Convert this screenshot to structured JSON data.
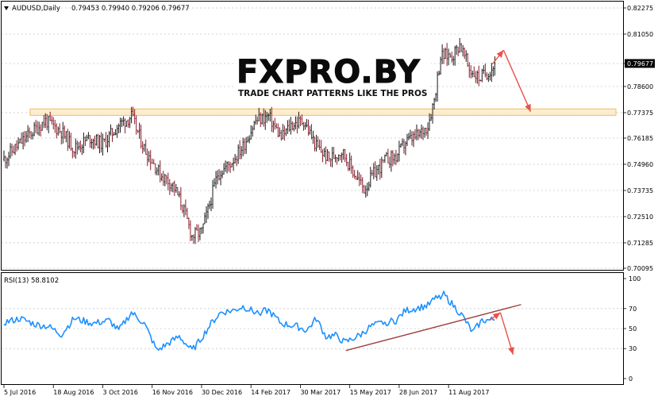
{
  "header": {
    "symbol_label": "AUDUSD,Daily",
    "ohlc": "0.79453 0.79940 0.79206 0.79677"
  },
  "logo": {
    "title": "FXPRO.BY",
    "tagline": "TRADE CHART PATTERNS LIKE THE PROS"
  },
  "rsi_header": {
    "label": "RSI(13) 58.8102"
  },
  "current_price_label": "0.79677",
  "colors": {
    "bull": "#1a1a1a",
    "bear": "#8a1c2a",
    "rsi_line": "#1e90ff",
    "arrow": "#e8524a",
    "trendline": "#a04040",
    "zone_fill": "#fdebc8",
    "zone_stroke": "#f0b040",
    "grid": "#c8c8c8"
  },
  "chart_data": [
    {
      "type": "candlestick",
      "title": "AUDUSD,Daily",
      "ylim": [
        0.70095,
        0.82275
      ],
      "y_ticks": [
        "0.82275",
        "0.81050",
        "0.79677",
        "0.78600",
        "0.77375",
        "0.76185",
        "0.74960",
        "0.73735",
        "0.72510",
        "0.71285",
        "0.70095"
      ],
      "x_tick_labels": [
        "5 Jul 2016",
        "18 Aug 2016",
        "3 Oct 2016",
        "16 Nov 2016",
        "30 Dec 2016",
        "14 Feb 2017",
        "30 Mar 2017",
        "15 May 2017",
        "28 Jun 2017",
        "11 Aug 2017"
      ],
      "last_close": 0.79677,
      "path_nodes": [
        [
          0,
          0.752
        ],
        [
          8,
          0.758
        ],
        [
          18,
          0.765
        ],
        [
          26,
          0.77
        ],
        [
          36,
          0.765
        ],
        [
          44,
          0.757
        ],
        [
          54,
          0.762
        ],
        [
          62,
          0.759
        ],
        [
          72,
          0.768
        ],
        [
          80,
          0.772
        ],
        [
          88,
          0.757
        ],
        [
          94,
          0.75
        ],
        [
          98,
          0.745
        ],
        [
          106,
          0.74
        ],
        [
          112,
          0.73
        ],
        [
          118,
          0.716
        ],
        [
          124,
          0.718
        ],
        [
          128,
          0.728
        ],
        [
          134,
          0.745
        ],
        [
          142,
          0.75
        ],
        [
          150,
          0.758
        ],
        [
          158,
          0.77
        ],
        [
          166,
          0.772
        ],
        [
          174,
          0.762
        ],
        [
          180,
          0.768
        ],
        [
          188,
          0.77
        ],
        [
          196,
          0.758
        ],
        [
          204,
          0.752
        ],
        [
          212,
          0.756
        ],
        [
          220,
          0.745
        ],
        [
          226,
          0.738
        ],
        [
          232,
          0.745
        ],
        [
          240,
          0.752
        ],
        [
          246,
          0.753
        ],
        [
          252,
          0.76
        ],
        [
          260,
          0.763
        ],
        [
          266,
          0.768
        ],
        [
          270,
          0.78
        ],
        [
          274,
          0.8
        ],
        [
          282,
          0.801
        ],
        [
          286,
          0.806
        ],
        [
          292,
          0.794
        ],
        [
          298,
          0.79
        ],
        [
          304,
          0.793
        ],
        [
          308,
          0.796
        ]
      ],
      "resistance_zone": [
        0.7725,
        0.7755
      ],
      "arrow_projection": [
        [
          307,
          0.7965
        ],
        [
          314,
          0.803
        ],
        [
          331,
          0.7742
        ]
      ]
    },
    {
      "type": "line",
      "title": "RSI(13) 58.8102",
      "ylim": [
        0,
        100
      ],
      "y_ticks": [
        100,
        70,
        50,
        30,
        0
      ],
      "series": [
        {
          "name": "RSI(13)",
          "last": 58.8102
        }
      ],
      "rsi_nodes": [
        [
          0,
          56
        ],
        [
          10,
          60
        ],
        [
          20,
          54
        ],
        [
          28,
          52
        ],
        [
          36,
          44
        ],
        [
          44,
          60
        ],
        [
          56,
          55
        ],
        [
          66,
          58
        ],
        [
          72,
          48
        ],
        [
          80,
          66
        ],
        [
          88,
          55
        ],
        [
          96,
          28
        ],
        [
          104,
          36
        ],
        [
          110,
          42
        ],
        [
          118,
          28
        ],
        [
          122,
          36
        ],
        [
          130,
          55
        ],
        [
          136,
          66
        ],
        [
          144,
          68
        ],
        [
          150,
          72
        ],
        [
          158,
          66
        ],
        [
          166,
          68
        ],
        [
          174,
          55
        ],
        [
          184,
          52
        ],
        [
          190,
          48
        ],
        [
          196,
          60
        ],
        [
          202,
          42
        ],
        [
          208,
          43
        ],
        [
          214,
          36
        ],
        [
          224,
          44
        ],
        [
          230,
          52
        ],
        [
          238,
          56
        ],
        [
          246,
          58
        ],
        [
          252,
          68
        ],
        [
          258,
          70
        ],
        [
          266,
          73
        ],
        [
          272,
          82
        ],
        [
          276,
          84
        ],
        [
          282,
          73
        ],
        [
          288,
          62
        ],
        [
          294,
          46
        ],
        [
          300,
          58
        ],
        [
          308,
          58.8
        ]
      ],
      "trendline": [
        [
          215,
          28
        ],
        [
          325,
          74
        ]
      ],
      "arrow_projection": [
        [
          305,
          58
        ],
        [
          312,
          66
        ],
        [
          320,
          24
        ]
      ]
    }
  ]
}
